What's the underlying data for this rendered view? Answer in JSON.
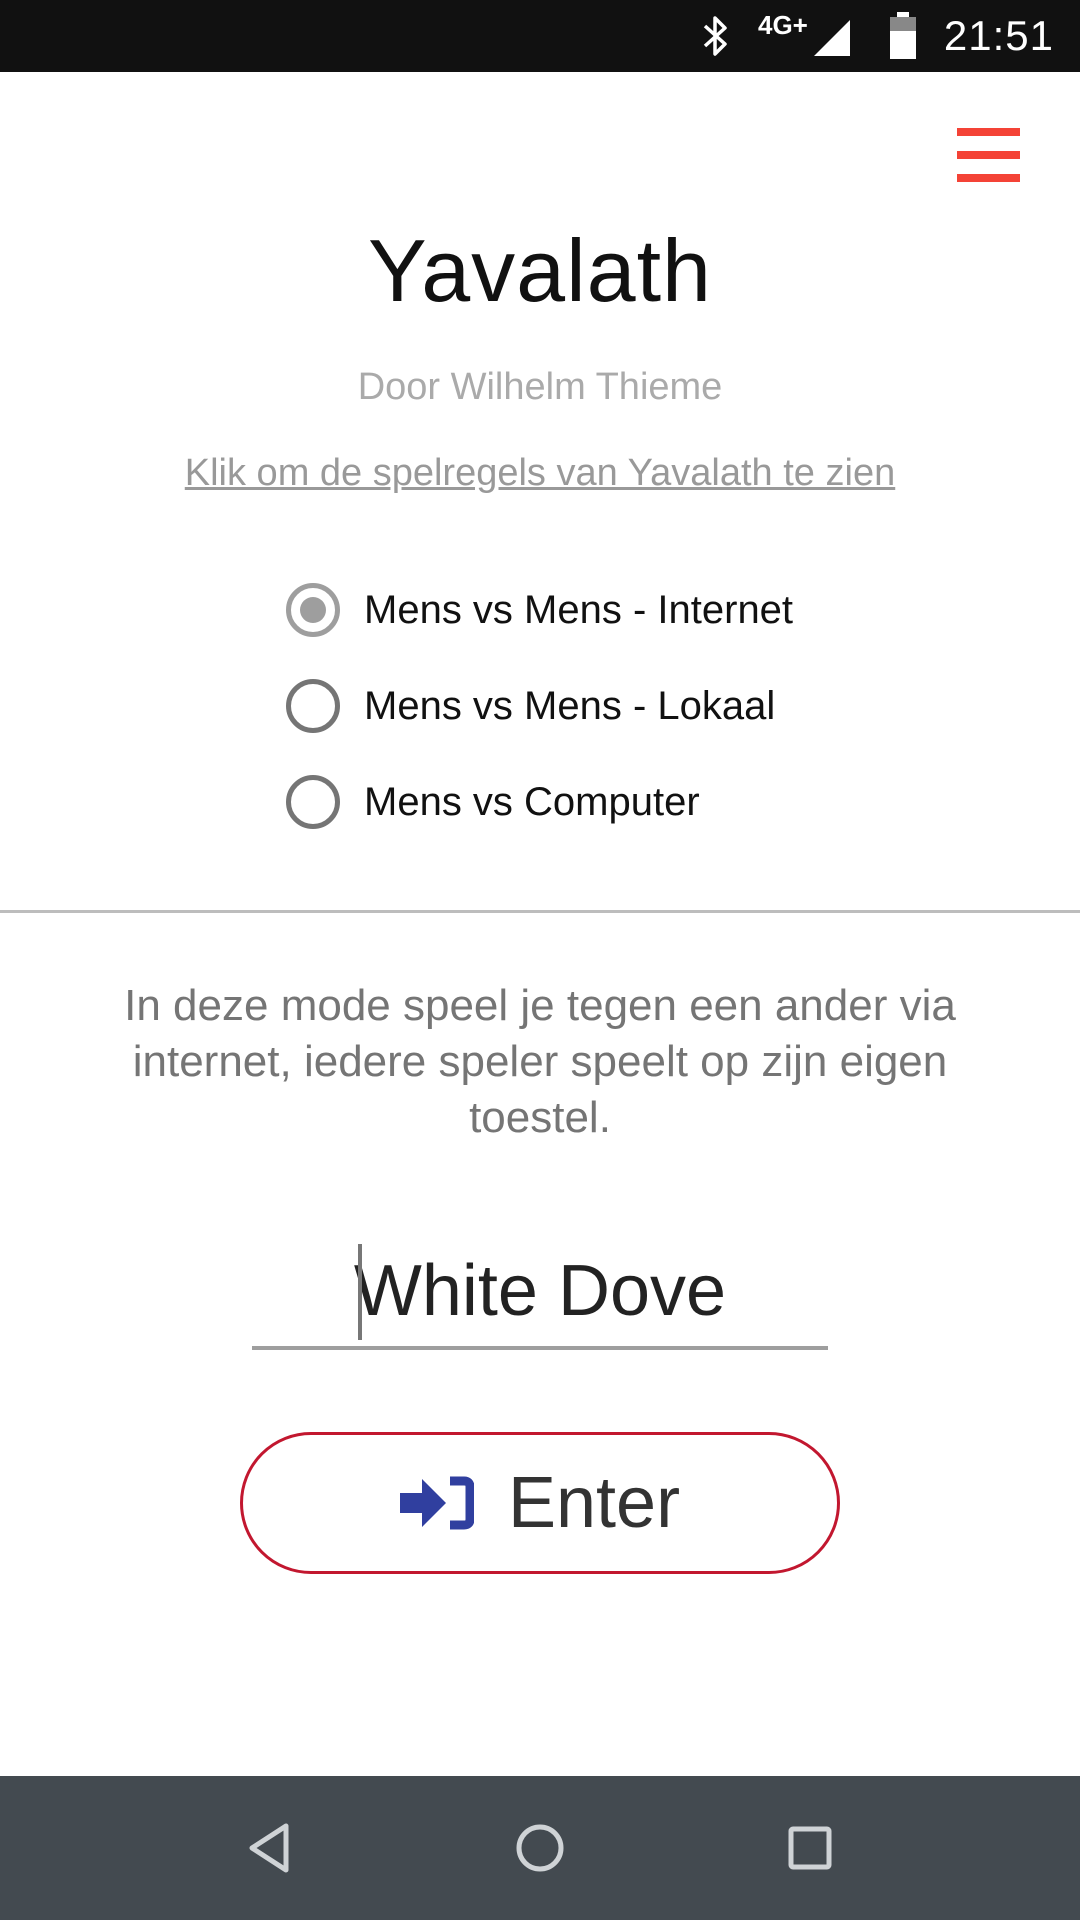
{
  "status_bar": {
    "network": "4G+",
    "time": "21:51",
    "icons": [
      "bluetooth-icon",
      "signal-icon",
      "battery-icon"
    ]
  },
  "header": {
    "menu_icon": "hamburger-menu-icon",
    "menu_color": "#f44336"
  },
  "app": {
    "title": "Yavalath",
    "author": "Door Wilhelm Thieme",
    "rules_link": "Klik om de spelregels van Yavalath te zien"
  },
  "modes": {
    "selected": 0,
    "options": [
      {
        "label": "Mens vs Mens - Internet",
        "checked": true
      },
      {
        "label": "Mens vs Mens - Lokaal",
        "checked": false
      },
      {
        "label": "Mens vs Computer",
        "checked": false
      }
    ]
  },
  "description": "In deze mode speel je tegen een ander via internet, iedere speler speelt op zijn eigen toestel.",
  "name_input": {
    "value": "White Dove"
  },
  "enter_button": {
    "label": "Enter",
    "icon": "sign-in-icon",
    "icon_color": "#303f9f",
    "border_color": "#c2172f"
  },
  "nav_bar": {
    "buttons": [
      "back-icon",
      "home-icon",
      "recents-icon"
    ]
  }
}
